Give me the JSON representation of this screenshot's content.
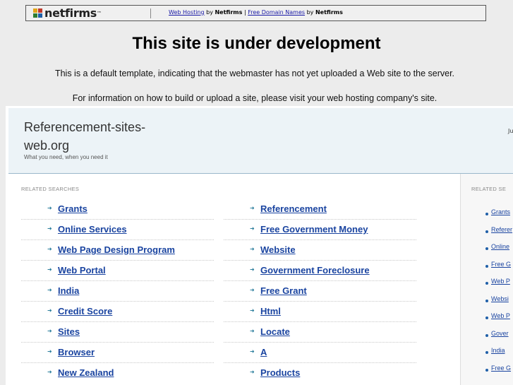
{
  "topbar": {
    "logo_text": "netfirms",
    "logo_tm": "™",
    "link1": "Web Hosting",
    "by1": " by ",
    "brand1": "Netfirms",
    "sep": " | ",
    "link2": "Free Domain Names",
    "by2": " by ",
    "brand2": "Netfirms"
  },
  "headline": "This site is under development",
  "info_line_1": "This is a default template, indicating that the webmaster has not yet uploaded a Web site to the server.",
  "info_line_2": "For information on how to build or upload a site, please visit your web hosting company's site.",
  "frame": {
    "site_title": "Referencement-sites-web.org",
    "tagline": "What you need, when you need it",
    "right_note": "Ju",
    "main_section_label": "RELATED SEARCHES",
    "side_section_label": "RELATED SE",
    "left_links": [
      "Grants",
      "Online Services",
      "Web Page Design Program",
      "Web Portal",
      "India",
      "Credit Score",
      "Sites",
      "Browser",
      "New Zealand"
    ],
    "right_links": [
      "Referencement",
      "Free Government Money",
      "Website",
      "Government Foreclosure",
      "Free Grant",
      "Html",
      "Locate",
      "A",
      "Products"
    ],
    "side_links": [
      "Grants",
      "Referer",
      "Online",
      "Free G",
      "Web P",
      "Websi",
      "Web P",
      "Gover",
      "India",
      "Free G"
    ]
  }
}
